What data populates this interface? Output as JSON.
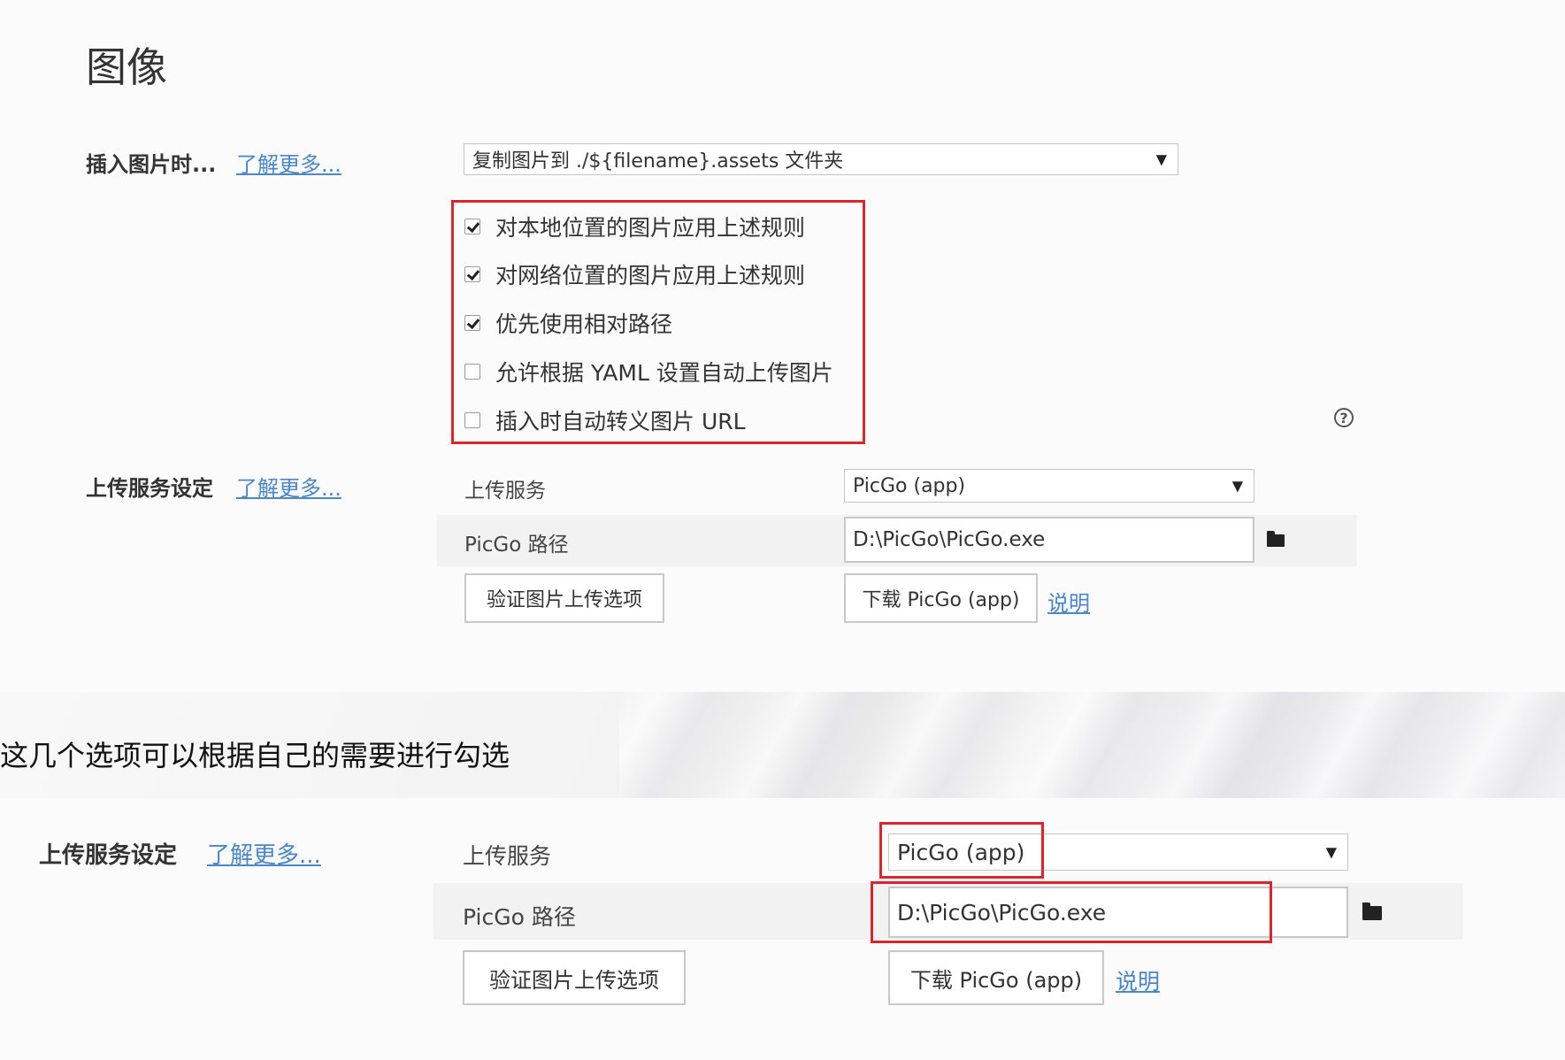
{
  "top": {
    "title": "图像",
    "insert_label": "插入图片时...",
    "insert_learn_more": "了解更多...",
    "insert_select_value": "复制图片到 ./${filename}.assets 文件夹",
    "checkboxes": [
      {
        "label": "对本地位置的图片应用上述规则",
        "checked": true
      },
      {
        "label": "对网络位置的图片应用上述规则",
        "checked": true
      },
      {
        "label": "优先使用相对路径",
        "checked": true
      },
      {
        "label": "允许根据 YAML 设置自动上传图片",
        "checked": false
      },
      {
        "label": "插入时自动转义图片 URL",
        "checked": false
      }
    ],
    "help_icon_glyph": "?",
    "upload_label": "上传服务设定",
    "upload_learn_more": "了解更多...",
    "service_label": "上传服务",
    "service_value": "PicGo (app)",
    "path_label": "PicGo 路径",
    "path_value": "D:\\PicGo\\PicGo.exe",
    "verify_button": "验证图片上传选项",
    "download_button": "下载 PicGo (app)",
    "docs_link": "说明"
  },
  "note": "这几个选项可以根据自己的需要进行勾选",
  "bottom": {
    "upload_label": "上传服务设定",
    "upload_learn_more": "了解更多...",
    "service_label": "上传服务",
    "service_value": "PicGo (app)",
    "path_label": "PicGo 路径",
    "path_value": "D:\\PicGo\\PicGo.exe",
    "verify_button": "验证图片上传选项",
    "download_button": "下载 PicGo (app)",
    "docs_link": "说明"
  },
  "icons": {
    "dropdown_arrow": "▼"
  },
  "colors": {
    "highlight_red": "#d9262c",
    "link_blue": "#4a86c8"
  }
}
